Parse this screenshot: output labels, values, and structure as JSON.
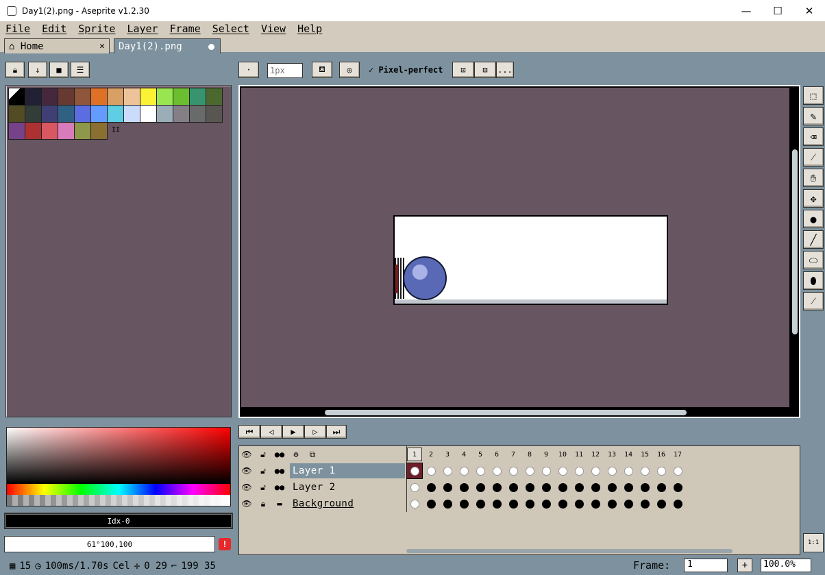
{
  "window": {
    "title": "Day1(2).png - Aseprite v1.2.30",
    "minimize": "—",
    "maximize": "☐",
    "close": "✕"
  },
  "menu": [
    "File",
    "Edit",
    "Sprite",
    "Layer",
    "Frame",
    "Select",
    "View",
    "Help"
  ],
  "tabs": {
    "home": "Home",
    "file": "Day1(2).png",
    "close": "✕"
  },
  "toolbar": {
    "brush_size_placeholder": "1px",
    "pixel_perfect": "Pixel-perfect",
    "more": "..."
  },
  "palette": {
    "colors": [
      "#000000",
      "#222034",
      "#45283c",
      "#663931",
      "#8f563b",
      "#df7126",
      "#d9a066",
      "#eec39a",
      "#fbf236",
      "#99e550",
      "#6abe30",
      "#37946e",
      "#4b692f",
      "#524b24",
      "#323c39",
      "#3f3f74",
      "#306082",
      "#5b6ee1",
      "#639bff",
      "#5fcde4",
      "#cbdbfc",
      "#ffffff",
      "#9badb7",
      "#847e87",
      "#696a6a",
      "#595652",
      "#76428a",
      "#ac3232",
      "#d95763",
      "#d77bba",
      "#8f974a",
      "#8a6f30"
    ],
    "resize_handle": "II"
  },
  "color": {
    "index": "Idx-0",
    "rgba": "61°100,100",
    "warning": "!"
  },
  "timeline": {
    "layers": [
      "Layer 1",
      "Layer 2",
      "Background"
    ],
    "frames": [
      "1",
      "2",
      "3",
      "4",
      "5",
      "6",
      "7",
      "8",
      "9",
      "10",
      "11",
      "12",
      "13",
      "14",
      "15",
      "16",
      "17"
    ]
  },
  "status": {
    "frames": "15",
    "duration": "100ms/1.70s",
    "cel": "Cel",
    "pos": "0 29",
    "size": "199 35",
    "frame_label": "Frame:",
    "frame_value": "1",
    "zoom": "100.0%",
    "one_to_one": "1:1"
  }
}
